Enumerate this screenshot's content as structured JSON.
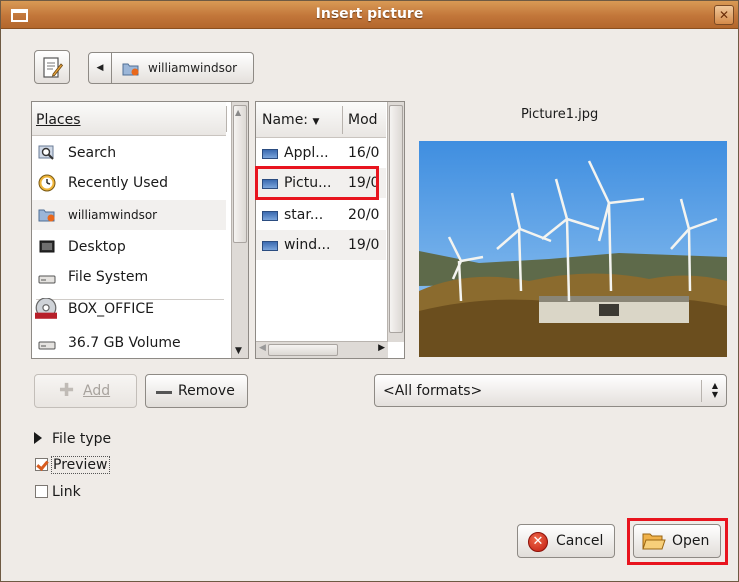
{
  "window": {
    "title": "Insert picture"
  },
  "toolbar": {
    "path_label": "williamwindsor"
  },
  "places": {
    "header": "Places",
    "items": [
      {
        "label": "Search",
        "icon": "search-icon"
      },
      {
        "label": "Recently Used",
        "icon": "recently-used-icon"
      },
      {
        "label": "williamwindsor",
        "icon": "home-folder-icon"
      },
      {
        "label": "Desktop",
        "icon": "desktop-icon"
      },
      {
        "label": "File System",
        "icon": "drive-icon"
      },
      {
        "label": "BOX_OFFICE",
        "icon": "dvd-icon"
      },
      {
        "label": "36.7 GB Volume",
        "icon": "drive-icon"
      }
    ]
  },
  "files": {
    "col_name": "Name:",
    "col_mod": "Mod",
    "rows": [
      {
        "name": "Appl...",
        "date": "16/0"
      },
      {
        "name": "Pictu...",
        "date": "19/0"
      },
      {
        "name": "star...",
        "date": "20/0"
      },
      {
        "name": "wind...",
        "date": "19/0"
      }
    ]
  },
  "preview": {
    "filename": "Picture1.jpg"
  },
  "buttons": {
    "add_label": "Add",
    "remove_label": "Remove",
    "cancel_label": "Cancel",
    "open_label": "Open"
  },
  "format": {
    "selected": "<All formats>"
  },
  "options": {
    "file_type": "File type",
    "preview": "Preview",
    "link": "Link",
    "preview_checked": true,
    "link_checked": false
  },
  "colors": {
    "title_bar": "#c2763a",
    "highlight": "#e8141e"
  }
}
